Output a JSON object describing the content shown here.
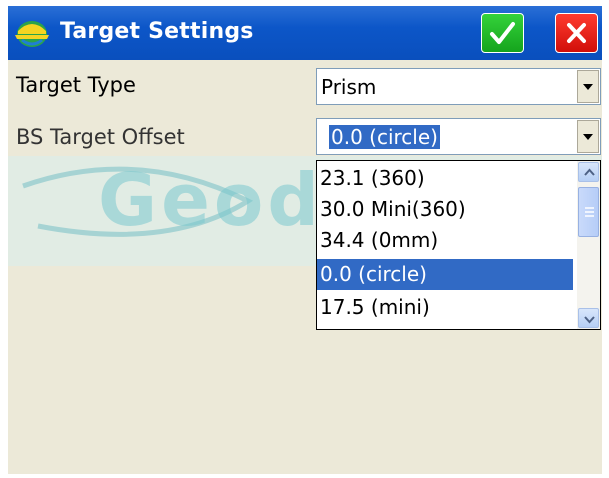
{
  "window": {
    "title": "Target Settings",
    "icons": {
      "app": "survey-helmet-icon",
      "ok": "checkmark-icon",
      "cancel": "close-x-icon"
    },
    "colors": {
      "titlebar": "#0c56c8",
      "ok": "#20b526",
      "cancel": "#e01a12",
      "selection": "#316ac5"
    }
  },
  "form": {
    "target_type": {
      "label": "Target Type",
      "value": "Prism"
    },
    "bs_target_offset": {
      "label": "BS Target Offset",
      "value": "0.0 (circle)"
    }
  },
  "dropdown": {
    "options": [
      "23.1 (360)",
      "30.0 Mini(360)",
      "34.4 (0mm)",
      "0.0 (circle)",
      "17.5 (mini)"
    ],
    "selected_index": 3
  },
  "watermark": {
    "text": "Geodesical"
  }
}
